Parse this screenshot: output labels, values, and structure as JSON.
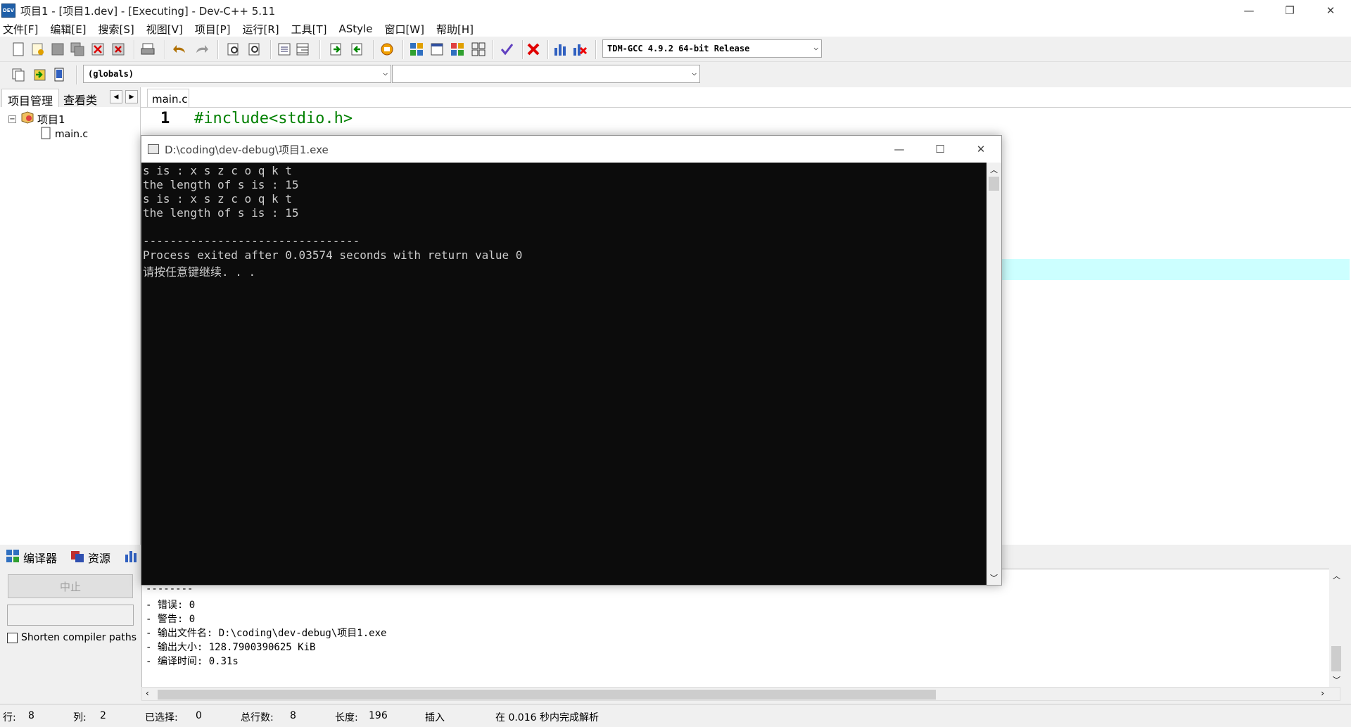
{
  "window": {
    "title": "项目1 - [项目1.dev] - [Executing] - Dev-C++ 5.11",
    "app_icon_text": "DEV",
    "minimize": "—",
    "restore": "❐",
    "close": "✕"
  },
  "menu": [
    "文件[F]",
    "编辑[E]",
    "搜索[S]",
    "视图[V]",
    "项目[P]",
    "运行[R]",
    "工具[T]",
    "AStyle",
    "窗口[W]",
    "帮助[H]"
  ],
  "toolbar": {
    "compiler": "TDM-GCC 4.9.2 64-bit Release",
    "scope": "(globals)",
    "function": ""
  },
  "left_panel": {
    "tab_project": "项目管理",
    "tab_classes": "查看类",
    "tree_project": "项目1",
    "tree_file": "main.c"
  },
  "editor": {
    "tab": "main.c",
    "line_number": "1",
    "code_line": "#include<stdio.h>"
  },
  "console": {
    "title": "D:\\coding\\dev-debug\\项目1.exe",
    "lines": [
      "s is : x s z c o q k t",
      "the length of s is : 15",
      "s is : x s z c o q k t",
      "the length of s is : 15",
      "",
      "--------------------------------",
      "Process exited after 0.03574 seconds with return value 0",
      "请按任意键继续. . ."
    ]
  },
  "bottom_tabs": {
    "compiler": "编译器",
    "resources": "资源"
  },
  "bottom_left": {
    "stop_button": "中止",
    "shorten_paths": "Shorten compiler paths"
  },
  "output": [
    "--------",
    "- 错误: 0",
    "- 警告: 0",
    "- 输出文件名: D:\\coding\\dev-debug\\项目1.exe",
    "- 输出大小: 128.7900390625 KiB",
    "- 编译时间: 0.31s"
  ],
  "status": {
    "row_label": "行:",
    "row": "8",
    "col_label": "列:",
    "col": "2",
    "sel_label": "已选择:",
    "sel": "0",
    "lines_label": "总行数:",
    "lines": "8",
    "len_label": "长度:",
    "len": "196",
    "mode": "插入",
    "parse": "在 0.016 秒内完成解析"
  }
}
